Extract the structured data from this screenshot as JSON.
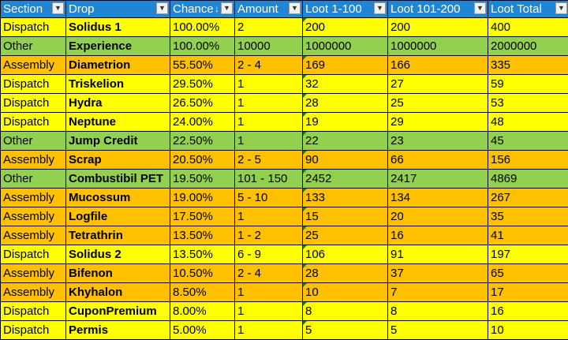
{
  "headers": [
    "Section",
    "Drop",
    "Chance",
    "Amount",
    "Loot 1-100",
    "Loot 101-200",
    "Loot Total"
  ],
  "sorted_column_indicator": "↓",
  "filter_icon_glyph": "▼",
  "colors": {
    "header_bg": "#1f86d6",
    "dispatch": "#ffff00",
    "other": "#92d050",
    "assembly": "#ffc000"
  },
  "rows": [
    {
      "section": "Dispatch",
      "drop": "Solidus 1",
      "chance": "100.00%",
      "amount": "2",
      "loot1": "200",
      "loot2": "200",
      "total": "400"
    },
    {
      "section": "Other",
      "drop": "Experience",
      "chance": "100.00%",
      "amount": "10000",
      "loot1": "1000000",
      "loot2": "1000000",
      "total": "2000000"
    },
    {
      "section": "Assembly",
      "drop": "Diametrion",
      "chance": "55.50%",
      "amount": "2 - 4",
      "loot1": "169",
      "loot2": "166",
      "total": "335"
    },
    {
      "section": "Dispatch",
      "drop": "Triskelion",
      "chance": "29.50%",
      "amount": "1",
      "loot1": "32",
      "loot2": "27",
      "total": "59"
    },
    {
      "section": "Dispatch",
      "drop": "Hydra",
      "chance": "26.50%",
      "amount": "1",
      "loot1": "28",
      "loot2": "25",
      "total": "53"
    },
    {
      "section": "Dispatch",
      "drop": "Neptune",
      "chance": "24.00%",
      "amount": "1",
      "loot1": "19",
      "loot2": "29",
      "total": "48"
    },
    {
      "section": "Other",
      "drop": "Jump Credit",
      "chance": "22.50%",
      "amount": "1",
      "loot1": "22",
      "loot2": "23",
      "total": "45"
    },
    {
      "section": "Assembly",
      "drop": "Scrap",
      "chance": "20.50%",
      "amount": "2 - 5",
      "loot1": "90",
      "loot2": "66",
      "total": "156"
    },
    {
      "section": "Other",
      "drop": "Combustibil PET",
      "chance": "19.50%",
      "amount": "101 - 150",
      "loot1": "2452",
      "loot2": "2417",
      "total": "4869"
    },
    {
      "section": "Assembly",
      "drop": "Mucossum",
      "chance": "19.00%",
      "amount": "5 - 10",
      "loot1": "133",
      "loot2": "134",
      "total": "267"
    },
    {
      "section": "Assembly",
      "drop": "Logfile",
      "chance": "17.50%",
      "amount": "1",
      "loot1": "15",
      "loot2": "20",
      "total": "35"
    },
    {
      "section": "Assembly",
      "drop": "Tetrathrin",
      "chance": "13.50%",
      "amount": "1 - 2",
      "loot1": "25",
      "loot2": "16",
      "total": "41"
    },
    {
      "section": "Dispatch",
      "drop": "Solidus 2",
      "chance": "13.50%",
      "amount": "6 - 9",
      "loot1": "106",
      "loot2": "91",
      "total": "197"
    },
    {
      "section": "Assembly",
      "drop": "Bifenon",
      "chance": "10.50%",
      "amount": "2 - 4",
      "loot1": "28",
      "loot2": "37",
      "total": "65"
    },
    {
      "section": "Assembly",
      "drop": "Khyhalon",
      "chance": "8.50%",
      "amount": "1",
      "loot1": "10",
      "loot2": "7",
      "total": "17"
    },
    {
      "section": "Dispatch",
      "drop": "CuponPremium",
      "chance": "8.00%",
      "amount": "1",
      "loot1": "8",
      "loot2": "8",
      "total": "16"
    },
    {
      "section": "Dispatch",
      "drop": "Permis",
      "chance": "5.00%",
      "amount": "1",
      "loot1": "5",
      "loot2": "5",
      "total": "10"
    }
  ]
}
